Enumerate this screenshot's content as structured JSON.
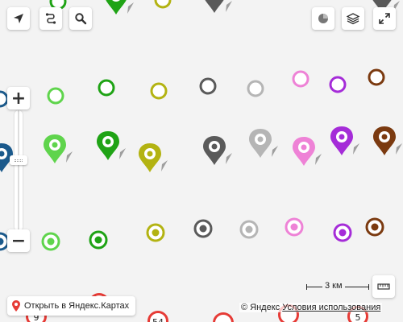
{
  "map": {
    "bg": "#f3f3f3",
    "markers": {
      "rings": [
        {
          "color": "#5fd44c"
        },
        {
          "color": "#1fa315"
        },
        {
          "color": "#b3b312"
        },
        {
          "color": "#5a5a5a"
        },
        {
          "color": "#b5b5b5"
        },
        {
          "color": "#ee82d6"
        },
        {
          "color": "#a52cd8"
        },
        {
          "color": "#7b3a10"
        }
      ],
      "pins": [
        {
          "color": "#5fd44c"
        },
        {
          "color": "#1fa315"
        },
        {
          "color": "#b3b312"
        },
        {
          "color": "#5a5a5a"
        },
        {
          "color": "#b5b5b5"
        },
        {
          "color": "#ee82d6"
        },
        {
          "color": "#a52cd8"
        },
        {
          "color": "#7b3a10"
        }
      ],
      "dots": [
        {
          "color": "#5fd44c"
        },
        {
          "color": "#1fa315"
        },
        {
          "color": "#b3b312"
        },
        {
          "color": "#5a5a5a"
        },
        {
          "color": "#b5b5b5"
        },
        {
          "color": "#ee82d6"
        },
        {
          "color": "#a52cd8"
        },
        {
          "color": "#7b3a10"
        }
      ],
      "top_pins": [
        {
          "color": "#1fa315"
        },
        {
          "color": "#5a5a5a"
        },
        {
          "color": "#5a5a5a"
        }
      ],
      "top_rings": [
        {
          "color": "#1fa315"
        },
        {
          "color": "#b3b312"
        }
      ],
      "left_markers": [
        {
          "color": "#1b5a8c"
        },
        {
          "color": "#1b5a8c"
        },
        {
          "color": "#1b5a8c"
        }
      ],
      "numbered": [
        {
          "label": "9"
        },
        {
          "label": ""
        },
        {
          "label": "54"
        },
        {
          "label": ""
        },
        {
          "label": ""
        },
        {
          "label": "5"
        }
      ]
    }
  },
  "controls": {
    "locate_icon": "locate-arrow-icon",
    "route_icon": "route-icon",
    "search_icon": "search-icon",
    "traffic_icon": "traffic-icon",
    "layers_icon": "layers-icon",
    "fullscreen_icon": "fullscreen-icon",
    "zoom_in_label": "+",
    "zoom_out_label": "−",
    "ruler_icon": "ruler-icon"
  },
  "footer": {
    "open_label": "Открыть в Яндекс.Картах",
    "scale_label": "3 км",
    "copyright": "© Яндекс",
    "terms": "Условия использования"
  }
}
